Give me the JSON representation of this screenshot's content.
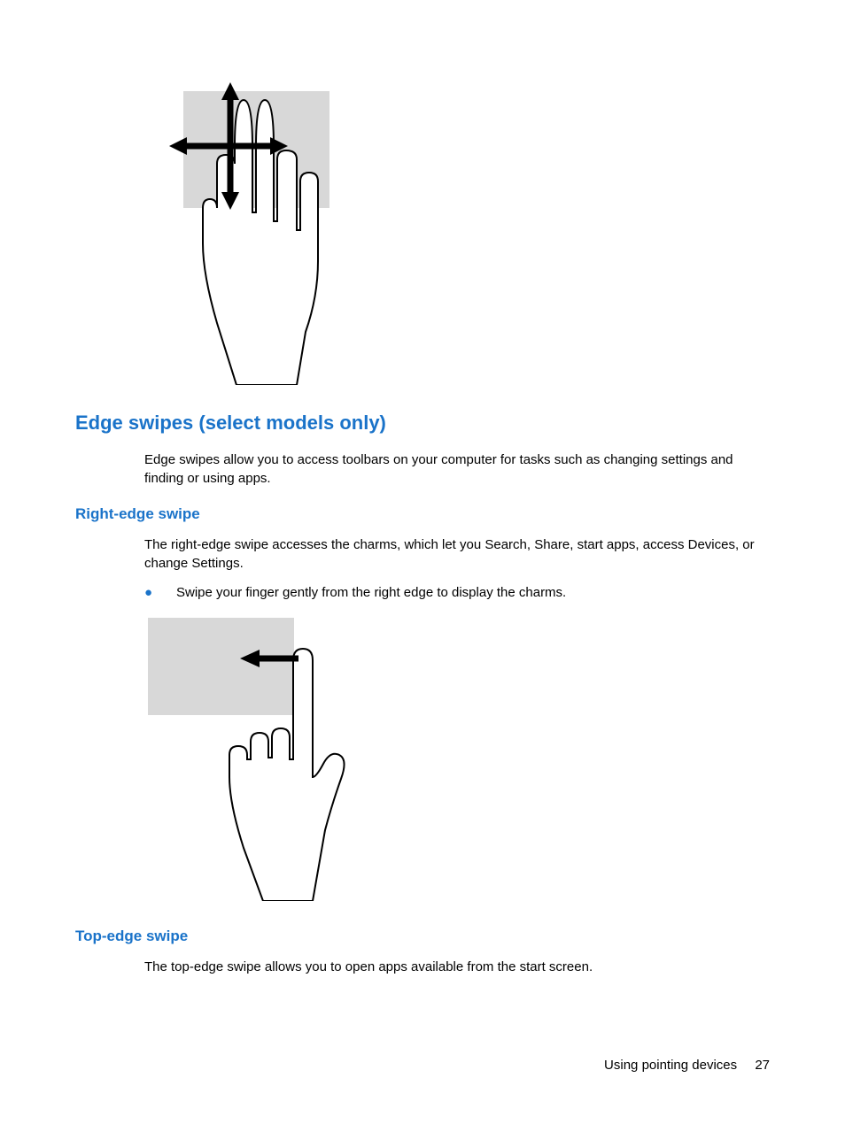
{
  "headings": {
    "edge_swipes": "Edge swipes (select models only)",
    "right_edge": "Right-edge swipe",
    "top_edge": "Top-edge swipe"
  },
  "paragraphs": {
    "edge_intro": "Edge swipes allow you to access toolbars on your computer for tasks such as changing settings and finding or using apps.",
    "right_edge_desc": "The right-edge swipe accesses the charms, which let you Search, Share, start apps, access Devices, or change Settings.",
    "right_edge_bullet": "Swipe your finger gently from the right edge to display the charms.",
    "top_edge_desc": "The top-edge swipe allows you to open apps available from the start screen."
  },
  "footer": {
    "section": "Using pointing devices",
    "page": "27"
  }
}
